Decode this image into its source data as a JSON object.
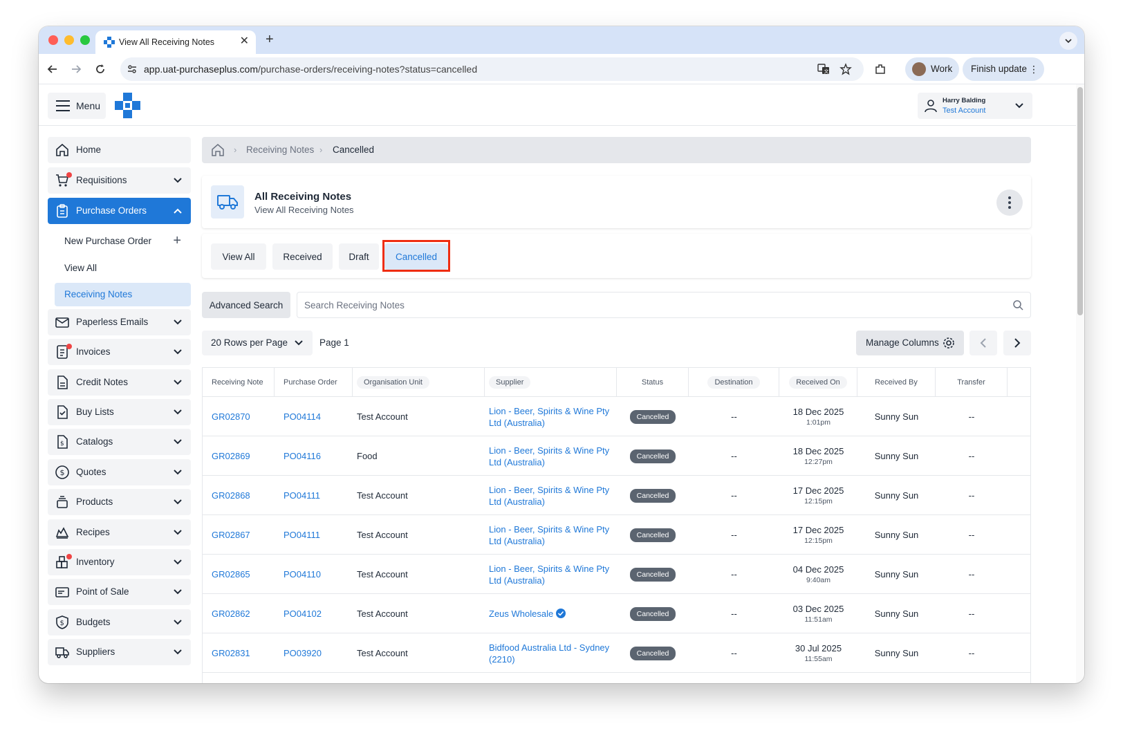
{
  "browser": {
    "tab_title": "View All Receiving Notes",
    "url_host": "app.uat-purchaseplus.com",
    "url_path": "/purchase-orders/receiving-notes?status=cancelled",
    "profile_label": "Work",
    "update_label": "Finish update"
  },
  "header": {
    "menu_label": "Menu",
    "user_name": "Harry Balding",
    "user_account": "Test Account"
  },
  "sidebar": {
    "items": [
      {
        "label": "Home"
      },
      {
        "label": "Requisitions"
      },
      {
        "label": "Purchase Orders"
      },
      {
        "label": "Paperless Emails"
      },
      {
        "label": "Invoices"
      },
      {
        "label": "Credit Notes"
      },
      {
        "label": "Buy Lists"
      },
      {
        "label": "Catalogs"
      },
      {
        "label": "Quotes"
      },
      {
        "label": "Products"
      },
      {
        "label": "Recipes"
      },
      {
        "label": "Inventory"
      },
      {
        "label": "Point of Sale"
      },
      {
        "label": "Budgets"
      },
      {
        "label": "Suppliers"
      }
    ],
    "sub_items": [
      {
        "label": "New Purchase Order"
      },
      {
        "label": "View All"
      },
      {
        "label": "Receiving Notes"
      }
    ]
  },
  "breadcrumb": {
    "items": [
      "Receiving Notes",
      "Cancelled"
    ]
  },
  "page": {
    "title": "All Receiving Notes",
    "subtitle": "View All Receiving Notes"
  },
  "filters": {
    "tabs": [
      "View All",
      "Received",
      "Draft",
      "Cancelled"
    ],
    "active": "Cancelled"
  },
  "search": {
    "advanced_label": "Advanced Search",
    "placeholder": "Search Receiving Notes"
  },
  "pagination": {
    "rows_label": "20 Rows per Page",
    "page_label": "Page 1",
    "manage_label": "Manage Columns"
  },
  "table": {
    "columns": [
      "Receiving Note",
      "Purchase Order",
      "Organisation Unit",
      "Supplier",
      "Status",
      "Destination",
      "Received On",
      "Received By",
      "Transfer"
    ],
    "rows": [
      {
        "note": "GR02870",
        "po": "PO04114",
        "unit": "Test Account",
        "supplier": "Lion - Beer, Spirits & Wine Pty Ltd (Australia)",
        "verified": false,
        "status": "Cancelled",
        "destination": "--",
        "date": "18 Dec 2025",
        "time": "1:01pm",
        "by": "Sunny Sun",
        "transfer": "--"
      },
      {
        "note": "GR02869",
        "po": "PO04116",
        "unit": "Food",
        "supplier": "Lion - Beer, Spirits & Wine Pty Ltd (Australia)",
        "verified": false,
        "status": "Cancelled",
        "destination": "--",
        "date": "18 Dec 2025",
        "time": "12:27pm",
        "by": "Sunny Sun",
        "transfer": "--"
      },
      {
        "note": "GR02868",
        "po": "PO04111",
        "unit": "Test Account",
        "supplier": "Lion - Beer, Spirits & Wine Pty Ltd (Australia)",
        "verified": false,
        "status": "Cancelled",
        "destination": "--",
        "date": "17 Dec 2025",
        "time": "12:15pm",
        "by": "Sunny Sun",
        "transfer": "--"
      },
      {
        "note": "GR02867",
        "po": "PO04111",
        "unit": "Test Account",
        "supplier": "Lion - Beer, Spirits & Wine Pty Ltd (Australia)",
        "verified": false,
        "status": "Cancelled",
        "destination": "--",
        "date": "17 Dec 2025",
        "time": "12:15pm",
        "by": "Sunny Sun",
        "transfer": "--"
      },
      {
        "note": "GR02865",
        "po": "PO04110",
        "unit": "Test Account",
        "supplier": "Lion - Beer, Spirits & Wine Pty Ltd (Australia)",
        "verified": false,
        "status": "Cancelled",
        "destination": "--",
        "date": "04 Dec 2025",
        "time": "9:40am",
        "by": "Sunny Sun",
        "transfer": "--"
      },
      {
        "note": "GR02862",
        "po": "PO04102",
        "unit": "Test Account",
        "supplier": "Zeus Wholesale",
        "verified": true,
        "status": "Cancelled",
        "destination": "--",
        "date": "03 Dec 2025",
        "time": "11:51am",
        "by": "Sunny Sun",
        "transfer": "--"
      },
      {
        "note": "GR02831",
        "po": "PO03920",
        "unit": "Test Account",
        "supplier": "Bidfood Australia Ltd - Sydney (2210)",
        "verified": false,
        "status": "Cancelled",
        "destination": "--",
        "date": "30 Jul 2025",
        "time": "11:55am",
        "by": "Sunny Sun",
        "transfer": "--"
      }
    ]
  },
  "colors": {
    "accent": "#1f78d8",
    "highlight": "#ef2d12",
    "status_pill": "#5b6470"
  }
}
